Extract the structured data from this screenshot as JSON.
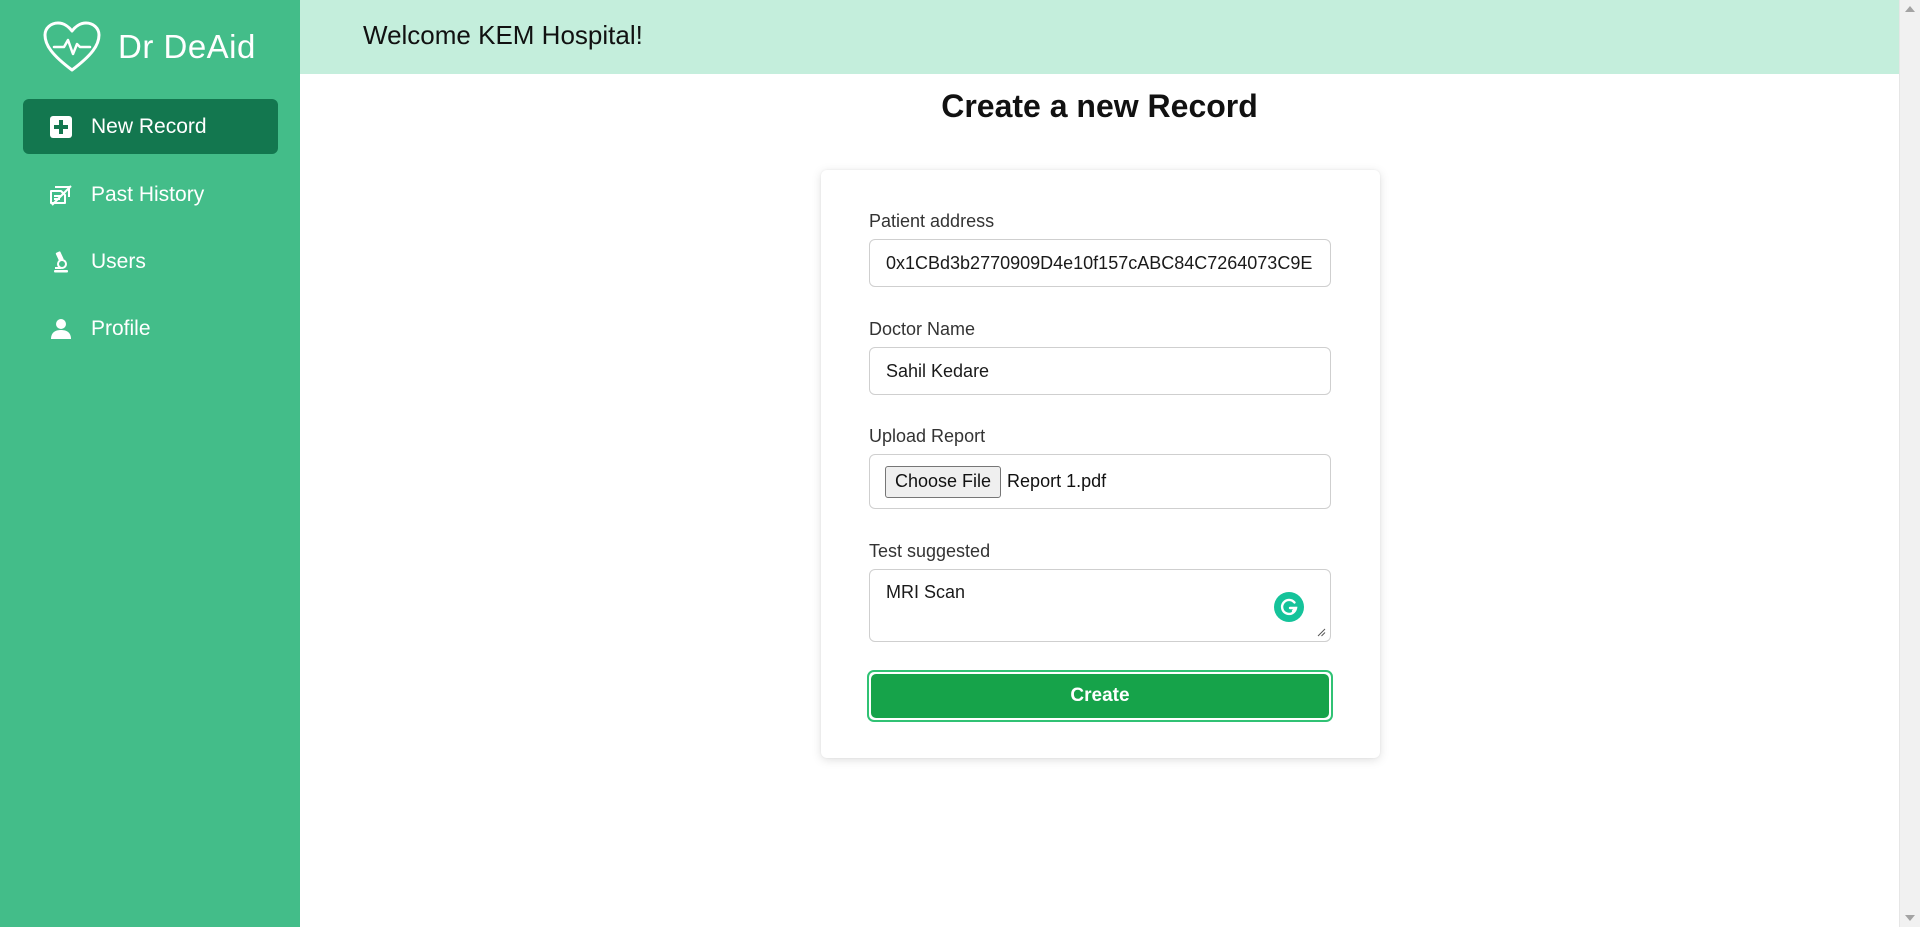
{
  "brand": {
    "name": "Dr DeAid",
    "logo_icon": "heart-pulse-icon"
  },
  "sidebar": {
    "items": [
      {
        "label": "New Record",
        "icon": "plus-square-icon",
        "active": true
      },
      {
        "label": "Past History",
        "icon": "history-icon",
        "active": false
      },
      {
        "label": "Users",
        "icon": "microscope-icon",
        "active": false
      },
      {
        "label": "Profile",
        "icon": "user-icon",
        "active": false
      }
    ]
  },
  "header": {
    "welcome": "Welcome KEM Hospital!"
  },
  "main": {
    "title": "Create a new Record",
    "form": {
      "patient_address": {
        "label": "Patient address",
        "value": "0x1CBd3b2770909D4e10f157cABC84C7264073C9E"
      },
      "doctor_name": {
        "label": "Doctor Name",
        "value": "Sahil Kedare"
      },
      "upload_report": {
        "label": "Upload Report",
        "button_label": "Choose File",
        "file_name": "Report 1.pdf"
      },
      "test_suggested": {
        "label": "Test suggested",
        "value": "MRI Scan"
      },
      "submit_label": "Create"
    }
  },
  "colors": {
    "sidebar_bg": "#43bd89",
    "sidebar_active": "#13774f",
    "header_bg": "#c4eedc",
    "button_green": "#16a34a",
    "grammarly": "#15c39a"
  }
}
